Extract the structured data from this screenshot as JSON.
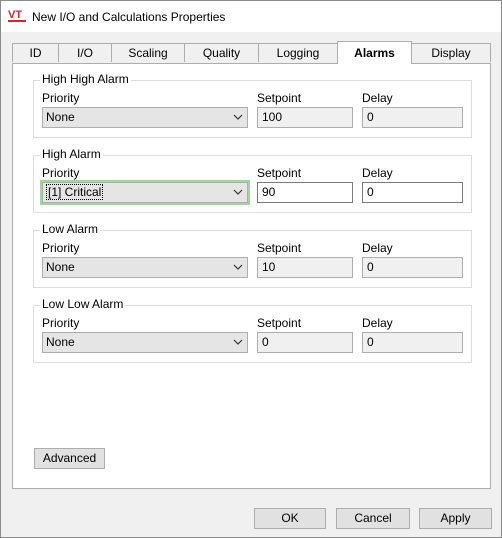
{
  "window": {
    "title": "New I/O and Calculations Properties",
    "icon": "vtscada-app-icon"
  },
  "tabs": [
    {
      "label": "ID",
      "active": false
    },
    {
      "label": "I/O",
      "active": false
    },
    {
      "label": "Scaling",
      "active": false
    },
    {
      "label": "Quality",
      "active": false
    },
    {
      "label": "Logging",
      "active": false
    },
    {
      "label": "Alarms",
      "active": true
    },
    {
      "label": "Display",
      "active": false
    }
  ],
  "labels": {
    "priority": "Priority",
    "setpoint": "Setpoint",
    "delay": "Delay"
  },
  "alarms": [
    {
      "title": "High High Alarm",
      "priority": "None",
      "setpoint": "100",
      "delay": "0",
      "editable": false
    },
    {
      "title": "High Alarm",
      "priority": "[1] Critical",
      "setpoint": "90",
      "delay": "0",
      "editable": true
    },
    {
      "title": "Low Alarm",
      "priority": "None",
      "setpoint": "10",
      "delay": "0",
      "editable": false
    },
    {
      "title": "Low Low Alarm",
      "priority": "None",
      "setpoint": "0",
      "delay": "0",
      "editable": false
    }
  ],
  "buttons": {
    "advanced": "Advanced",
    "ok": "OK",
    "cancel": "Cancel",
    "apply": "Apply"
  }
}
